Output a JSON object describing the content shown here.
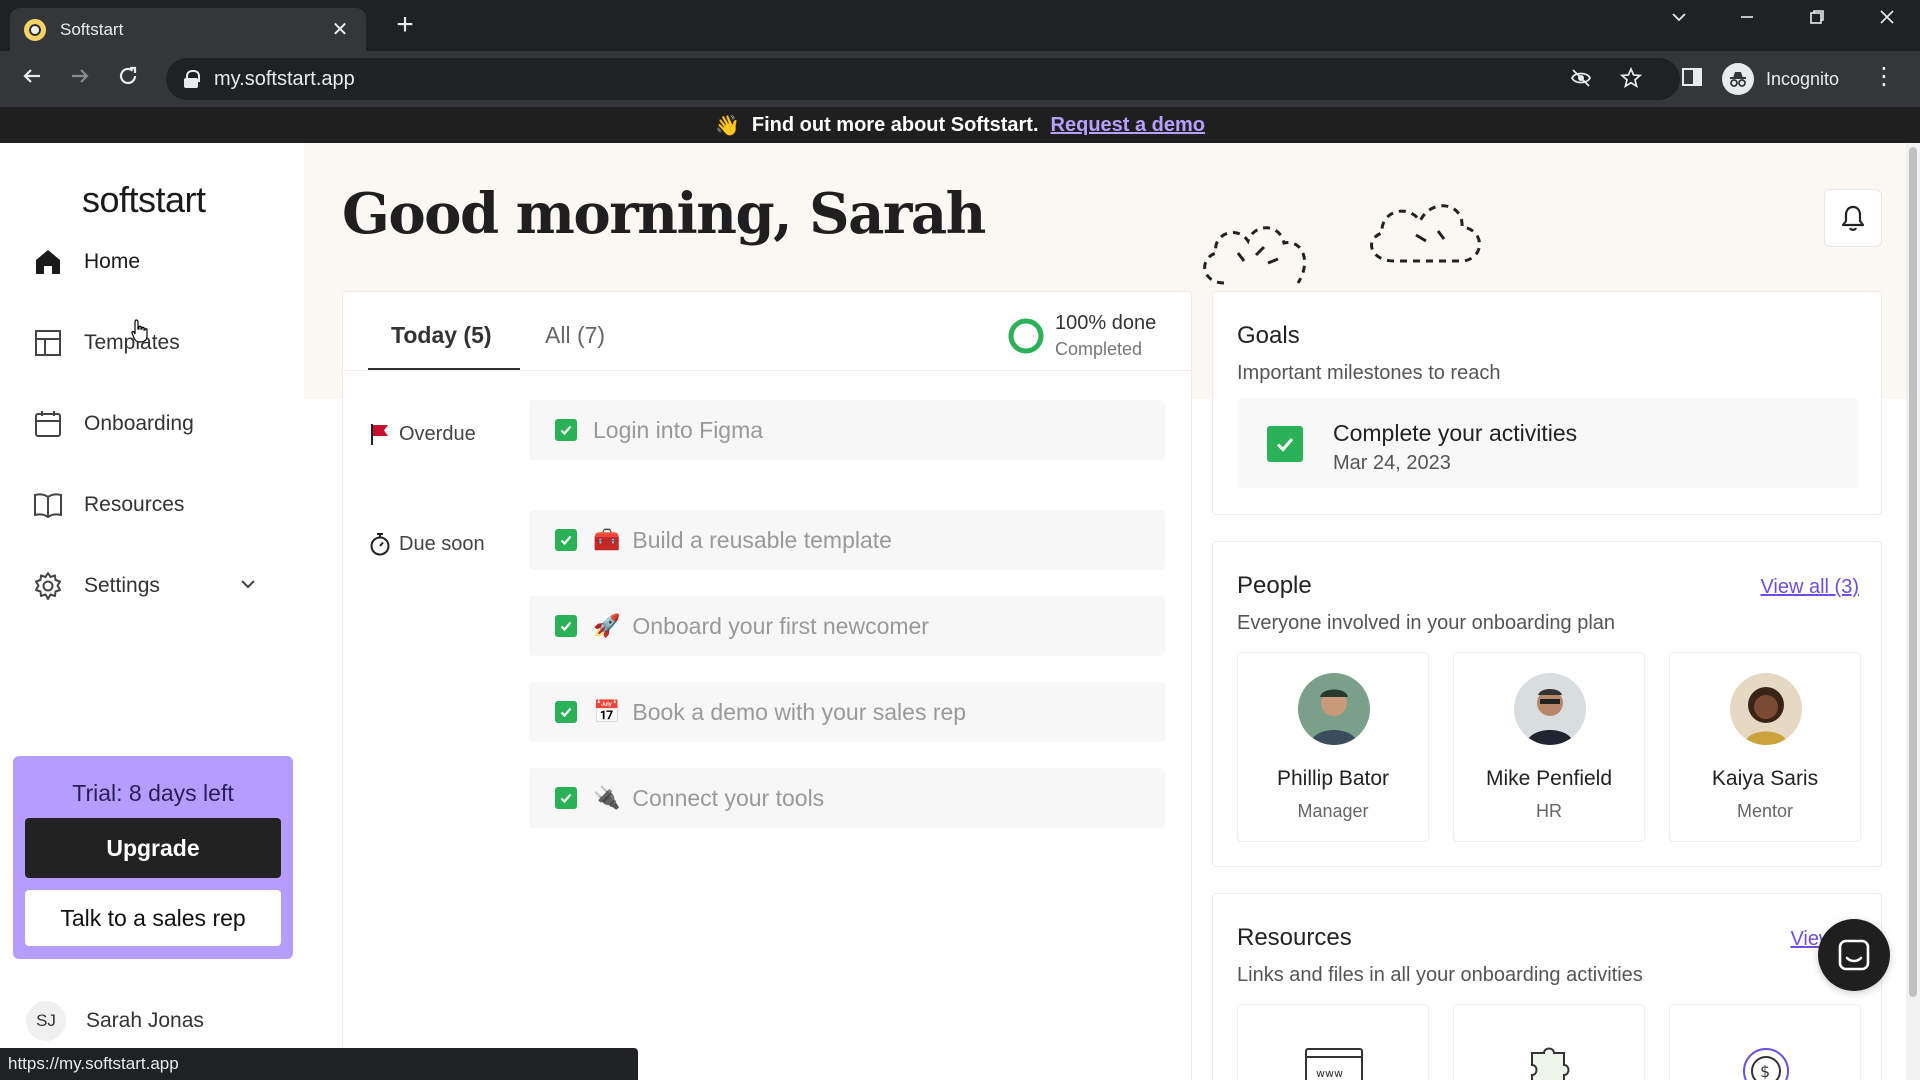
{
  "browser": {
    "tab_title": "Softstart",
    "tab_close": "✕",
    "new_tab": "+",
    "url": "my.softstart.app",
    "profile_label": "Incognito",
    "status_url": "https://my.softstart.app"
  },
  "banner": {
    "emoji": "👋",
    "text": "Find out more about Softstart.",
    "link": "Request a demo"
  },
  "sidebar": {
    "brand": "softstart",
    "items": [
      {
        "label": "Home",
        "icon": "home-icon"
      },
      {
        "label": "Templates",
        "icon": "templates-icon"
      },
      {
        "label": "Onboarding",
        "icon": "calendar-icon"
      },
      {
        "label": "Resources",
        "icon": "book-icon"
      },
      {
        "label": "Settings",
        "icon": "gear-icon"
      }
    ],
    "trial": {
      "text": "Trial: 8 days left",
      "upgrade": "Upgrade",
      "sales": "Talk to a sales rep"
    },
    "user": {
      "initials": "SJ",
      "name": "Sarah Jonas"
    }
  },
  "main": {
    "greeting": "Good morning, Sarah",
    "tabs": {
      "today": "Today (5)",
      "all": "All (7)"
    },
    "progress": {
      "main": "100% done",
      "sub": "Completed",
      "fraction": 1.0
    },
    "groups": {
      "overdue": "Overdue",
      "due_soon": "Due soon"
    },
    "tasks": [
      {
        "emoji": "",
        "title": "Login into Figma"
      },
      {
        "emoji": "🧰",
        "title": "Build a reusable template"
      },
      {
        "emoji": "🚀",
        "title": "Onboard your first newcomer"
      },
      {
        "emoji": "📅",
        "title": "Book a demo with your sales rep"
      },
      {
        "emoji": "🔌",
        "title": "Connect your tools"
      }
    ],
    "goals": {
      "title": "Goals",
      "subtitle": "Important milestones to reach",
      "item": {
        "title": "Complete your activities",
        "date": "Mar 24, 2023"
      }
    },
    "people": {
      "title": "People",
      "subtitle": "Everyone involved in your onboarding plan",
      "link": "View all (3)",
      "list": [
        {
          "name": "Phillip Bator",
          "role": "Manager"
        },
        {
          "name": "Mike Penfield",
          "role": "HR"
        },
        {
          "name": "Kaiya Saris",
          "role": "Mentor"
        }
      ]
    },
    "resources": {
      "title": "Resources",
      "subtitle": "Links and files in all your onboarding activities",
      "link": "View all"
    }
  },
  "colors": {
    "accent": "#b49dff",
    "link": "#6c4fe0",
    "check": "#2bb157",
    "banner_bg": "#1f1f1f"
  }
}
